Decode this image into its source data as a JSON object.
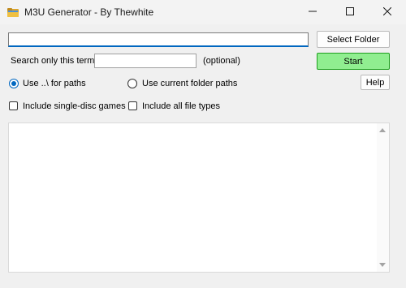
{
  "window": {
    "title": "M3U Generator - By Thewhite",
    "controls": [
      "minimize",
      "maximize",
      "close"
    ]
  },
  "path_field": {
    "value": ""
  },
  "buttons": {
    "select_folder": "Select Folder",
    "start": "Start",
    "help": "Help"
  },
  "search": {
    "label": "Search only this term:",
    "value": "",
    "hint": "(optional)"
  },
  "path_mode": {
    "options": [
      {
        "label": "Use ..\\ for paths",
        "checked": true
      },
      {
        "label": "Use current folder paths",
        "checked": false
      }
    ]
  },
  "checkboxes": [
    {
      "label": "Include single-disc games",
      "checked": false
    },
    {
      "label": "Include all file types",
      "checked": false
    }
  ],
  "output": {
    "text": ""
  },
  "colors": {
    "start_button": "#90ee90",
    "accent": "#0067c0",
    "background": "#f0f0f0"
  },
  "icons": {
    "app": "folder-icon",
    "minimize": "minimize-icon",
    "maximize": "maximize-icon",
    "close": "close-icon"
  }
}
